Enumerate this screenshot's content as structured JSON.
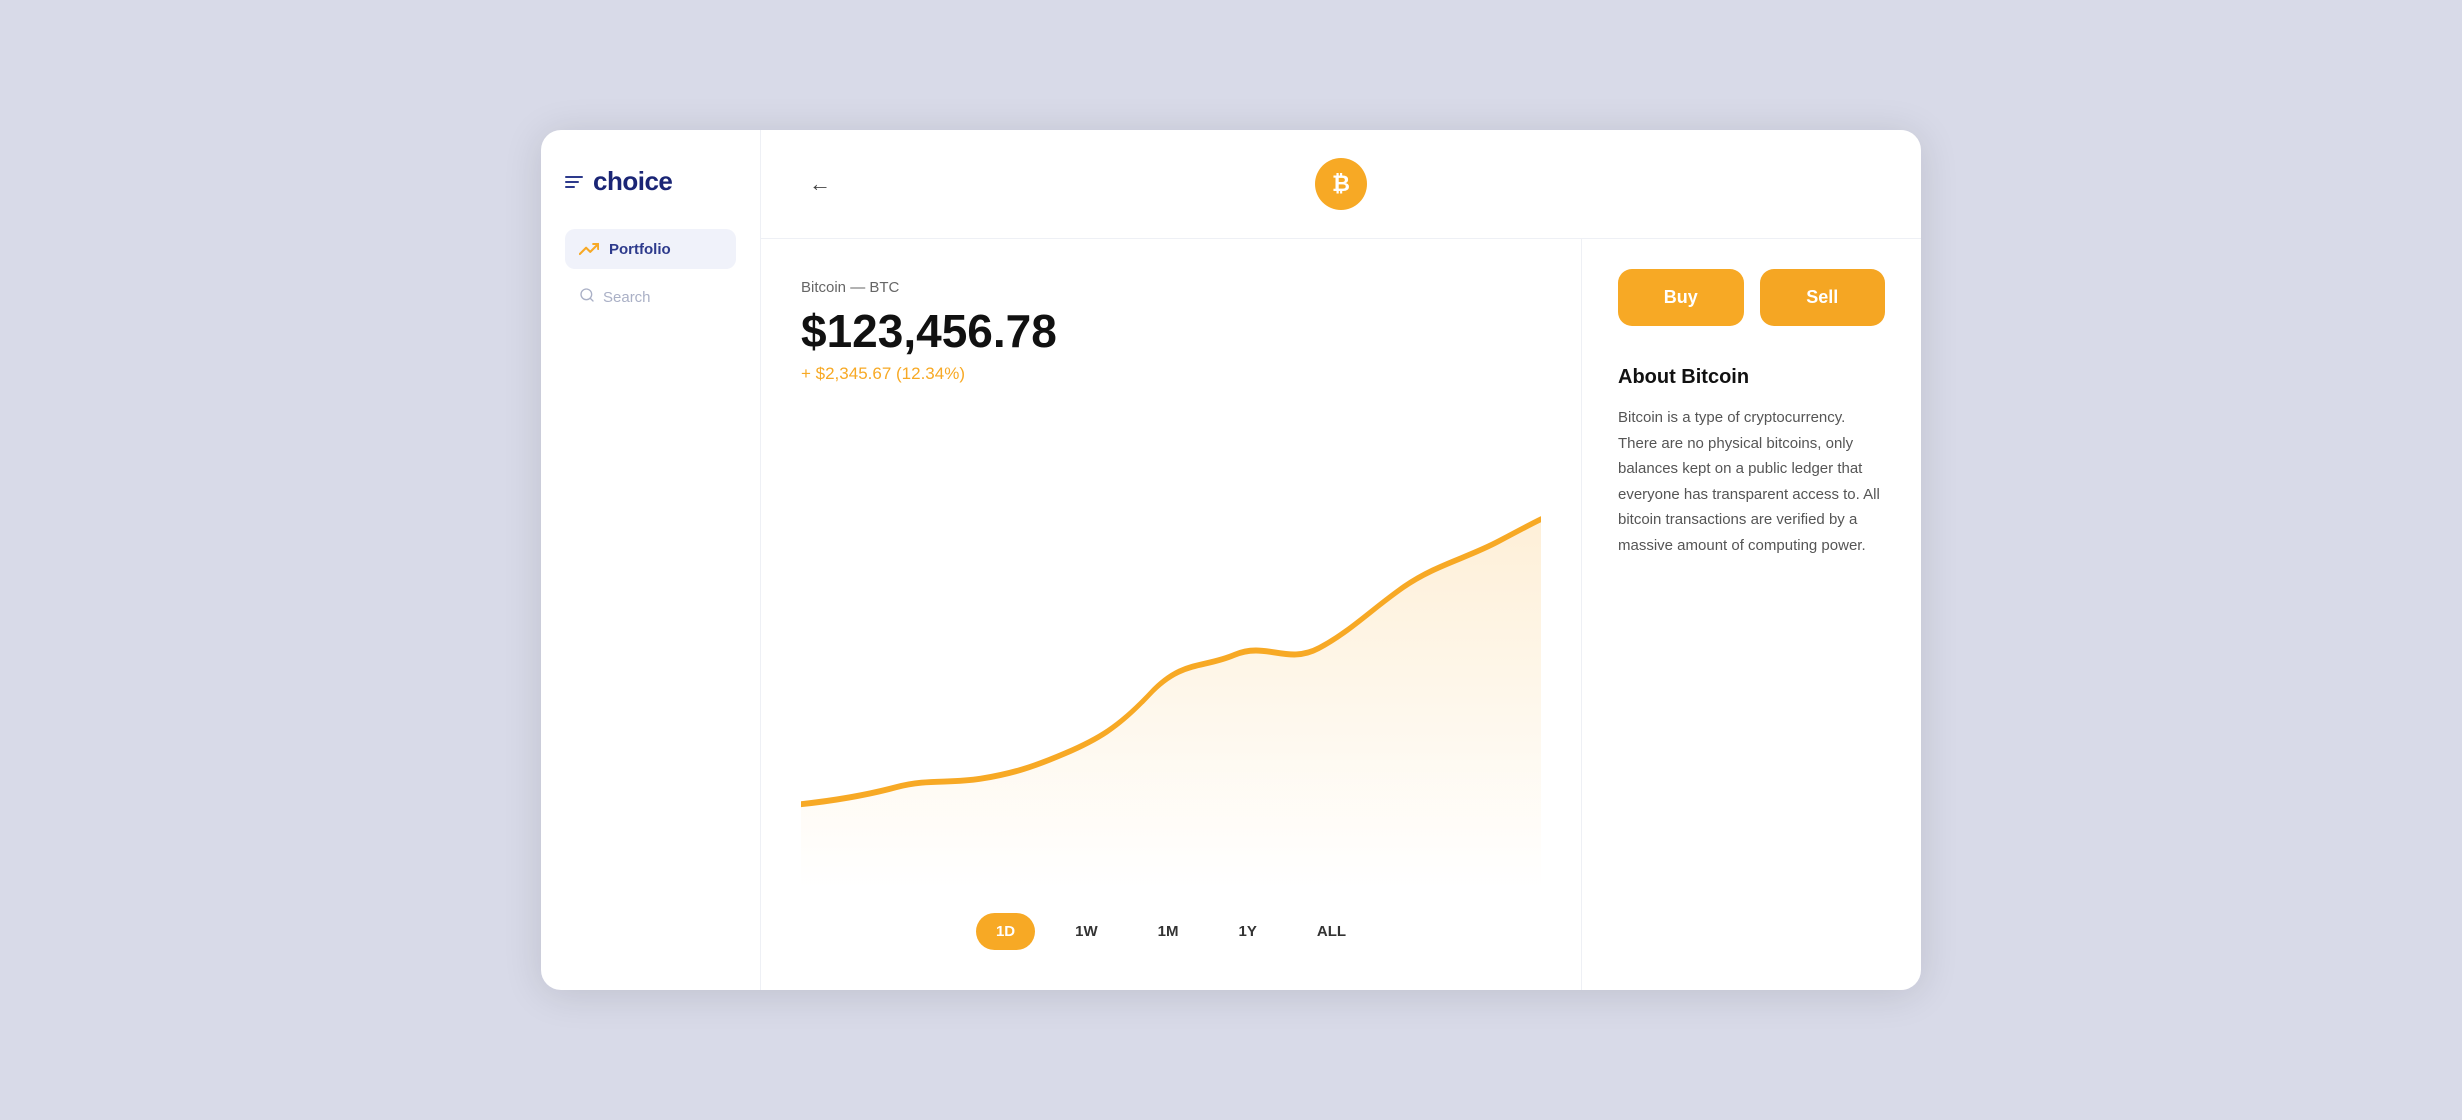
{
  "app": {
    "name": "choice",
    "logo_icon": "chart-up-icon"
  },
  "sidebar": {
    "nav_items": [
      {
        "id": "portfolio",
        "label": "Portfolio",
        "icon": "trending-up-icon",
        "active": true
      }
    ],
    "search": {
      "placeholder": "Search"
    }
  },
  "topbar": {
    "back_label": "←",
    "crypto_symbol": "₿"
  },
  "chart": {
    "coin_name": "Bitcoin",
    "coin_ticker": "BTC",
    "coin_label": "Bitcoin — BTC",
    "price": "$123,456.78",
    "change": "+ $2,345.67 (12.34%)",
    "time_tabs": [
      {
        "id": "1d",
        "label": "1D",
        "active": true
      },
      {
        "id": "1w",
        "label": "1W",
        "active": false
      },
      {
        "id": "1m",
        "label": "1M",
        "active": false
      },
      {
        "id": "1y",
        "label": "1Y",
        "active": false
      },
      {
        "id": "all",
        "label": "ALL",
        "active": false
      }
    ]
  },
  "actions": {
    "buy_label": "Buy",
    "sell_label": "Sell"
  },
  "about": {
    "title": "About Bitcoin",
    "text": "Bitcoin is a type of cryptocurrency. There are no physical bitcoins, only balances kept on a public ledger that everyone has transparent access to. All bitcoin transactions are verified by a massive amount of computing power."
  },
  "colors": {
    "brand": "#1a2575",
    "accent": "#f7a925",
    "chart_line": "#f7a925",
    "positive": "#f7a925"
  }
}
